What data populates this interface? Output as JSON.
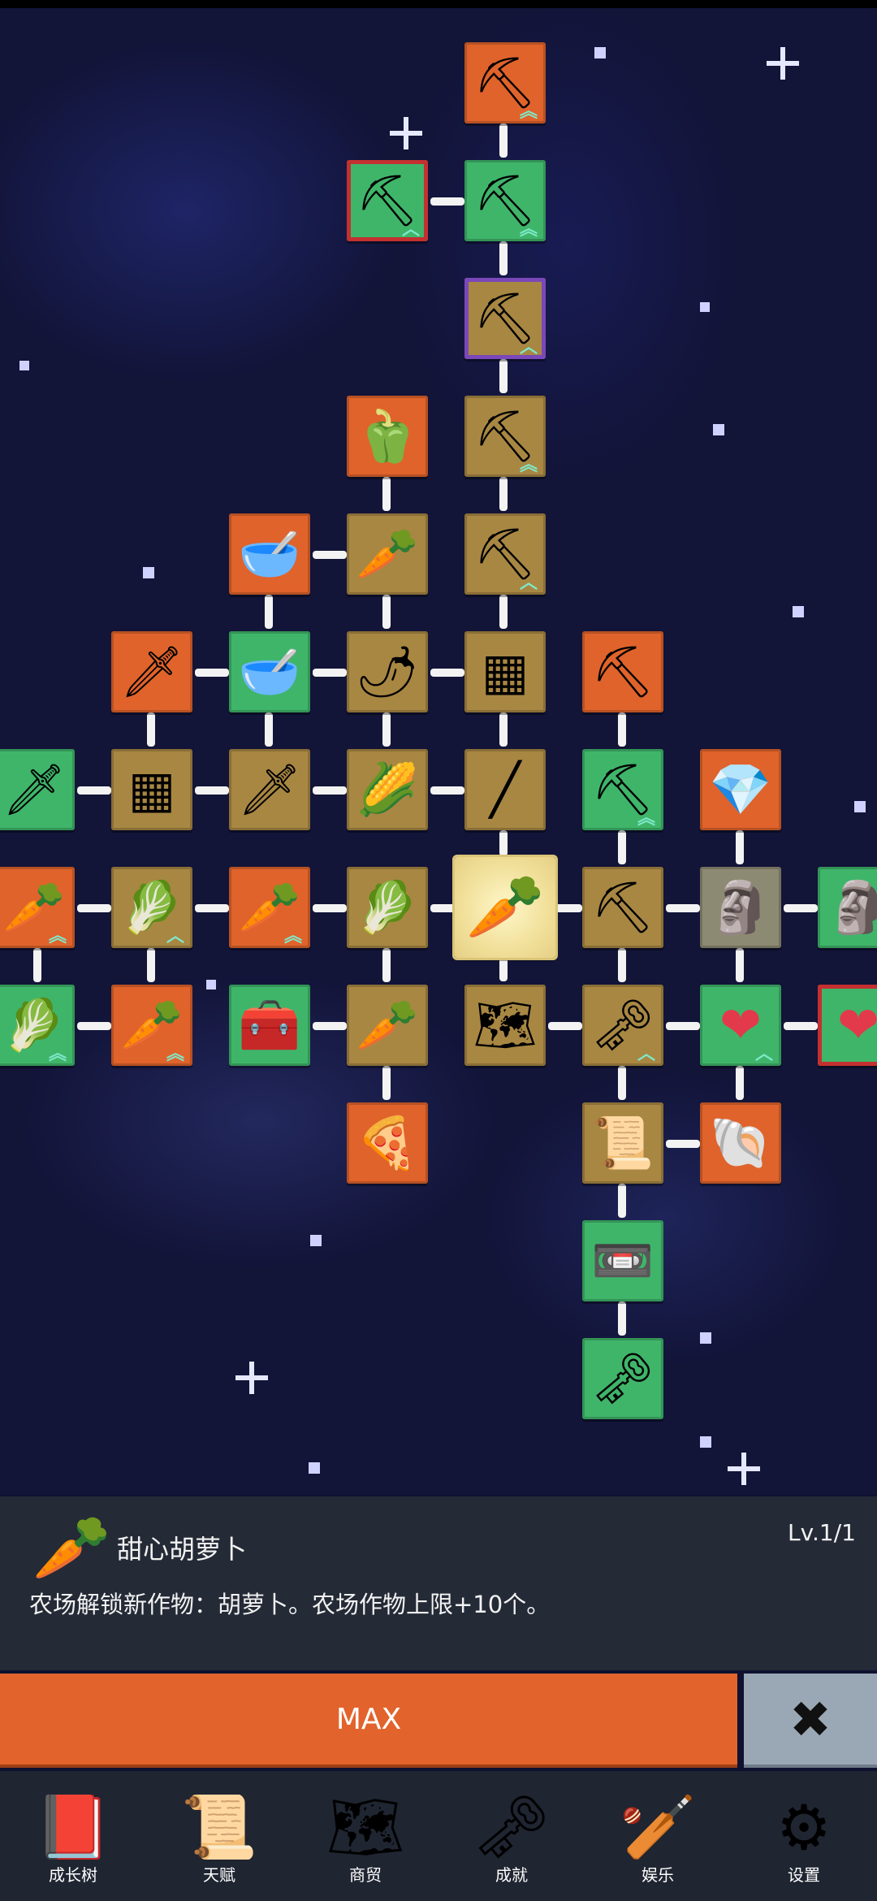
{
  "panel": {
    "icon": "carrot-icon",
    "title": "甜心胡萝卜",
    "level": "Lv.1/1",
    "description": "农场解锁新作物：胡萝卜。农场作物上限+10个。"
  },
  "buttons": {
    "max_label": "MAX",
    "close_icon": "close-icon"
  },
  "nav": {
    "items": [
      {
        "label": "成长树",
        "icon": "book-icon"
      },
      {
        "label": "天赋",
        "icon": "scroll-icon"
      },
      {
        "label": "商贸",
        "icon": "map-icon"
      },
      {
        "label": "成就",
        "icon": "key-icon"
      },
      {
        "label": "娱乐",
        "icon": "club-icon"
      },
      {
        "label": "设置",
        "icon": "gear-icon"
      }
    ]
  },
  "tree": {
    "nodes": [
      {
        "id": "n1",
        "icon": "shovel-icon",
        "color": "orange",
        "badge": "up"
      },
      {
        "id": "n2",
        "icon": "shovel-icon",
        "color": "green",
        "badge": "up"
      },
      {
        "id": "n3",
        "icon": "shovel-icon",
        "color": "green",
        "badge": "up"
      },
      {
        "id": "n4",
        "icon": "shovel-icon",
        "color": "brown",
        "badge": "up"
      },
      {
        "id": "n5",
        "icon": "pepper-icon",
        "color": "orange",
        "badge": ""
      },
      {
        "id": "n6",
        "icon": "shovel-icon",
        "color": "brown",
        "badge": "up"
      },
      {
        "id": "n7",
        "icon": "bowl-icon",
        "color": "orange",
        "badge": ""
      },
      {
        "id": "n8",
        "icon": "radish-icon",
        "color": "brown",
        "badge": ""
      },
      {
        "id": "n9",
        "icon": "shovel-icon",
        "color": "brown",
        "badge": "up"
      },
      {
        "id": "n10",
        "icon": "sword-icon",
        "color": "orange",
        "badge": ""
      },
      {
        "id": "n11",
        "icon": "bowl-icon",
        "color": "green",
        "badge": ""
      },
      {
        "id": "n12",
        "icon": "chili-icon",
        "color": "brown",
        "badge": ""
      },
      {
        "id": "n13",
        "icon": "crate-icon",
        "color": "brown",
        "badge": ""
      },
      {
        "id": "n14",
        "icon": "pickaxe-icon",
        "color": "orange",
        "badge": ""
      },
      {
        "id": "n15",
        "icon": "sword-icon",
        "color": "green",
        "badge": ""
      },
      {
        "id": "n16",
        "icon": "crate-icon",
        "color": "brown",
        "badge": ""
      },
      {
        "id": "n17",
        "icon": "sword-icon",
        "color": "brown",
        "badge": ""
      },
      {
        "id": "n18",
        "icon": "corn-icon",
        "color": "brown",
        "badge": ""
      },
      {
        "id": "n19",
        "icon": "rifle-icon",
        "color": "brown",
        "badge": ""
      },
      {
        "id": "n20",
        "icon": "pickaxe-icon",
        "color": "green",
        "badge": "up"
      },
      {
        "id": "n21",
        "icon": "crystal-icon",
        "color": "orange",
        "badge": ""
      },
      {
        "id": "n22",
        "icon": "carrot-icon",
        "color": "orange",
        "badge": "up"
      },
      {
        "id": "n23",
        "icon": "cabbage-icon",
        "color": "brown",
        "badge": "up"
      },
      {
        "id": "n24",
        "icon": "carrot-icon",
        "color": "orange",
        "badge": "up"
      },
      {
        "id": "n25",
        "icon": "cabbage-icon",
        "color": "brown",
        "badge": ""
      },
      {
        "id": "n26",
        "icon": "carrot-icon",
        "color": "selected",
        "badge": ""
      },
      {
        "id": "n27",
        "icon": "pickaxe-icon",
        "color": "brown",
        "badge": ""
      },
      {
        "id": "n28",
        "icon": "statue-icon",
        "color": "stone",
        "badge": ""
      },
      {
        "id": "n29",
        "icon": "statue-icon",
        "color": "green",
        "badge": ""
      },
      {
        "id": "n30",
        "icon": "cabbage-icon",
        "color": "green",
        "badge": "up"
      },
      {
        "id": "n31",
        "icon": "carrot-icon",
        "color": "orange",
        "badge": "up"
      },
      {
        "id": "n32",
        "icon": "chest-icon",
        "color": "green",
        "badge": ""
      },
      {
        "id": "n33",
        "icon": "parsnip-icon",
        "color": "brown",
        "badge": ""
      },
      {
        "id": "n34",
        "icon": "map-icon",
        "color": "brown",
        "badge": ""
      },
      {
        "id": "n35",
        "icon": "key-icon",
        "color": "brown",
        "badge": "up"
      },
      {
        "id": "n36",
        "icon": "heart-icon",
        "color": "green",
        "badge": "up"
      },
      {
        "id": "n37",
        "icon": "heart-icon",
        "color": "green",
        "badge": ""
      },
      {
        "id": "n38",
        "icon": "pizza-icon",
        "color": "orange",
        "badge": ""
      },
      {
        "id": "n39",
        "icon": "scroll-icon",
        "color": "brown",
        "badge": ""
      },
      {
        "id": "n40",
        "icon": "fossil-icon",
        "color": "orange",
        "badge": ""
      },
      {
        "id": "n41",
        "icon": "cassette-icon",
        "color": "green",
        "badge": ""
      },
      {
        "id": "n42",
        "icon": "key-icon",
        "color": "green",
        "badge": ""
      }
    ]
  }
}
